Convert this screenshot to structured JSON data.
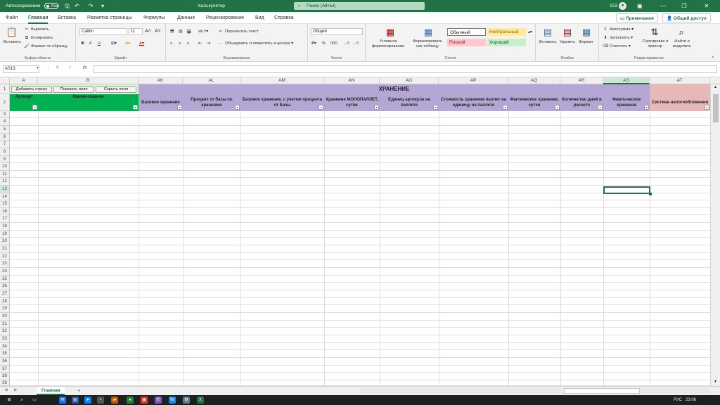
{
  "titlebar": {
    "autosave_label": "Автосохранение",
    "autosave_state": "Откл",
    "doc_title": "Калькулятор",
    "search_placeholder": "Поиск (Alt+Ы)",
    "counter": "153",
    "accent": "#217346"
  },
  "menu": {
    "tabs": [
      "Файл",
      "Главная",
      "Вставка",
      "Разметка страницы",
      "Формулы",
      "Данные",
      "Рецензирование",
      "Вид",
      "Справка"
    ],
    "active": "Главная",
    "notes": "Примечания",
    "share": "Общий доступ"
  },
  "ribbon": {
    "clipboard": {
      "label": "Буфер обмена",
      "paste": "Вставить",
      "cut": "Вырезать",
      "copy": "Копировать",
      "format_painter": "Формат по образцу"
    },
    "font": {
      "label": "Шрифт",
      "name": "Calibri",
      "size": "11",
      "bold": "Ж",
      "italic": "К",
      "underline": "Ч"
    },
    "alignment": {
      "label": "Выравнивание",
      "wrap": "Переносить текст",
      "merge": "Объединить и поместить в центре"
    },
    "number": {
      "label": "Число",
      "format": "Общий"
    },
    "styles": {
      "label": "Стили",
      "conditional": "Условное форматирование",
      "as_table": "Форматировать как таблицу",
      "normal": "Обычный",
      "neutral": "Нейтральный",
      "bad": "Плохой",
      "good": "Хороший"
    },
    "cells": {
      "label": "Ячейки",
      "insert": "Вставить",
      "delete": "Удалить",
      "format": "Формат"
    },
    "editing": {
      "label": "Редактирование",
      "autosum": "Автосумма",
      "fill": "Заполнить",
      "clear": "Очистить",
      "sort": "Сортировка и фильтр",
      "find": "Найти и выделить"
    }
  },
  "formula_bar": {
    "name_box": "AS13",
    "fx": "fx",
    "value": ""
  },
  "columns": [
    "A",
    "B",
    "AK",
    "AL",
    "AM",
    "AN",
    "AO",
    "AP",
    "AQ",
    "AR",
    "AS",
    "AT"
  ],
  "selected_column": "AS",
  "rows": [
    "1",
    "2",
    "3",
    "4",
    "5",
    "6",
    "7",
    "8",
    "9",
    "10",
    "11",
    "12",
    "13",
    "14",
    "15",
    "16",
    "17",
    "18",
    "19",
    "20",
    "21",
    "22",
    "23",
    "24",
    "25",
    "26",
    "27",
    "28",
    "29",
    "30",
    "31",
    "32",
    "33",
    "34",
    "35",
    "36",
    "37",
    "38",
    "39"
  ],
  "selected_row": "13",
  "sheet": {
    "buttons": [
      "Добавить строку",
      "Показать поля",
      "Скрыть поля"
    ],
    "storage_title": "ХРАНЕНИЕ",
    "headers": {
      "A": "Артикул",
      "B": "Наименование",
      "AK": "Базовое хранение",
      "AL": "Процент от базы по хранению",
      "AM": "Базовое хранение, с учетом процента от Базы",
      "AN": "Хранение МОНОПАЛЛЕТ, сутки",
      "AO": "Единиц артикула на паллете",
      "AP": "Стоимость хранения паллет на единицу на паллете",
      "AQ": "Фактическое хранение, сутки",
      "AR": "Количество дней в расчете",
      "AS": "Фактическое хранение",
      "AT": "Система налогообложения"
    },
    "colors": {
      "green": "#00b050",
      "purple": "#b4a7d6",
      "pink": "#e6b8b7"
    }
  },
  "tabs": {
    "active_sheet": "Главная",
    "add": "+"
  },
  "taskbar": {
    "lang": "РУС",
    "time": "23:06"
  }
}
